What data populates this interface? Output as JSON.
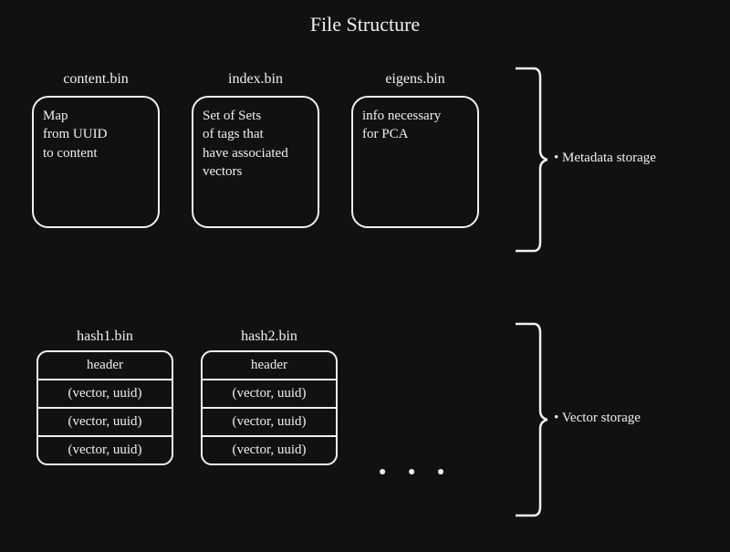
{
  "title": "File Structure",
  "meta": {
    "content": {
      "label": "content.bin",
      "body": "Map\nfrom UUID\nto content"
    },
    "index": {
      "label": "index.bin",
      "body": "Set of Sets\nof tags that\nhave associated\nvectors"
    },
    "eigens": {
      "label": "eigens.bin",
      "body": "info necessary\nfor PCA"
    },
    "bracket_label": "Metadata storage"
  },
  "vector": {
    "hash1": {
      "label": "hash1.bin",
      "rows": [
        "header",
        "(vector, uuid)",
        "(vector, uuid)",
        "(vector, uuid)"
      ]
    },
    "hash2": {
      "label": "hash2.bin",
      "rows": [
        "header",
        "(vector, uuid)",
        "(vector, uuid)",
        "(vector, uuid)"
      ]
    },
    "ellipsis": "● ● ●",
    "bracket_label": "Vector storage"
  },
  "bullet": "•"
}
